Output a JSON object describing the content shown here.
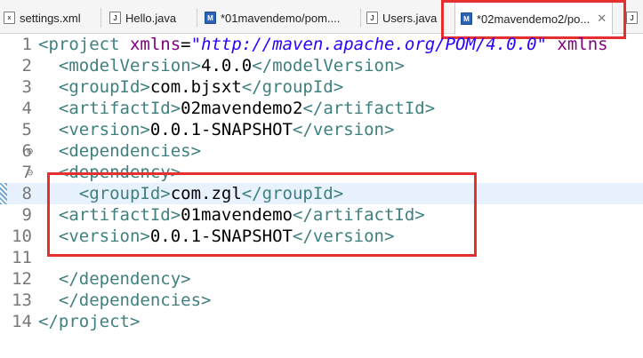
{
  "tabs": [
    {
      "label": "settings.xml",
      "icon": "xml-file-icon"
    },
    {
      "label": "Hello.java",
      "icon": "java-file-icon"
    },
    {
      "label": "*01mavendemo/pom....",
      "icon": "maven-pom-icon"
    },
    {
      "label": "Users.java",
      "icon": "java-file-icon"
    },
    {
      "label": "*02mavendemo2/po...",
      "icon": "maven-pom-icon",
      "active": true,
      "close": "✕"
    },
    {
      "label": "J",
      "icon": "java-file-icon"
    }
  ],
  "icon_glyphs": {
    "xml": "x",
    "java": "J",
    "pom": "M"
  },
  "lines": [
    {
      "n": "1",
      "fold": "",
      "parts": [
        [
          "tag",
          "<project "
        ],
        [
          "attr",
          "xmlns"
        ],
        [
          "txt",
          "="
        ],
        [
          "str",
          "\"http://maven.apache.org/POM/4.0.0\""
        ],
        [
          "attr",
          " xmlns"
        ]
      ]
    },
    {
      "n": "2",
      "fold": "",
      "parts": [
        [
          "txt",
          "  "
        ],
        [
          "tag",
          "<modelVersion>"
        ],
        [
          "txt",
          "4.0.0"
        ],
        [
          "tag",
          "</modelVersion>"
        ]
      ]
    },
    {
      "n": "3",
      "fold": "",
      "parts": [
        [
          "txt",
          "  "
        ],
        [
          "tag",
          "<groupId>"
        ],
        [
          "txt",
          "com.bjsxt"
        ],
        [
          "tag",
          "</groupId>"
        ]
      ]
    },
    {
      "n": "4",
      "fold": "",
      "parts": [
        [
          "txt",
          "  "
        ],
        [
          "tag",
          "<artifactId>"
        ],
        [
          "txt",
          "02mavendemo2"
        ],
        [
          "tag",
          "</artifactId>"
        ]
      ]
    },
    {
      "n": "5",
      "fold": "",
      "parts": [
        [
          "txt",
          "  "
        ],
        [
          "tag",
          "<version>"
        ],
        [
          "txt",
          "0.0.1-SNAPSHOT"
        ],
        [
          "tag",
          "</version>"
        ]
      ]
    },
    {
      "n": "6",
      "fold": "⊖",
      "parts": [
        [
          "txt",
          "  "
        ],
        [
          "tag",
          "<dependencies>"
        ]
      ]
    },
    {
      "n": "7",
      "fold": "⊖",
      "parts": [
        [
          "txt",
          "  "
        ],
        [
          "tag",
          "<dependency>"
        ]
      ]
    },
    {
      "n": "8",
      "fold": "",
      "current": true,
      "parts": [
        [
          "txt",
          "    "
        ],
        [
          "tag",
          "<groupId>"
        ],
        [
          "txt",
          "com.zgl"
        ],
        [
          "tag",
          "</groupId>"
        ]
      ]
    },
    {
      "n": "9",
      "fold": "",
      "parts": [
        [
          "txt",
          "  "
        ],
        [
          "tag",
          "<artifactId>"
        ],
        [
          "txt",
          "01mavendemo"
        ],
        [
          "tag",
          "</artifactId>"
        ]
      ]
    },
    {
      "n": "10",
      "fold": "",
      "parts": [
        [
          "txt",
          "  "
        ],
        [
          "tag",
          "<version>"
        ],
        [
          "txt",
          "0.0.1-SNAPSHOT"
        ],
        [
          "tag",
          "</version>"
        ]
      ]
    },
    {
      "n": "11",
      "fold": "",
      "parts": []
    },
    {
      "n": "12",
      "fold": "",
      "parts": [
        [
          "txt",
          "  "
        ],
        [
          "tag",
          "</dependency>"
        ]
      ]
    },
    {
      "n": "13",
      "fold": "",
      "parts": [
        [
          "txt",
          "  "
        ],
        [
          "tag",
          "</dependencies>"
        ]
      ]
    },
    {
      "n": "14",
      "fold": "",
      "parts": [
        [
          "tag",
          "</project>"
        ]
      ]
    }
  ],
  "colors": {
    "highlight_box": "#e5302f",
    "current_line": "#e8f2fe",
    "tag": "#3f7f7f",
    "attr": "#7f007f",
    "string": "#2a00ff"
  }
}
